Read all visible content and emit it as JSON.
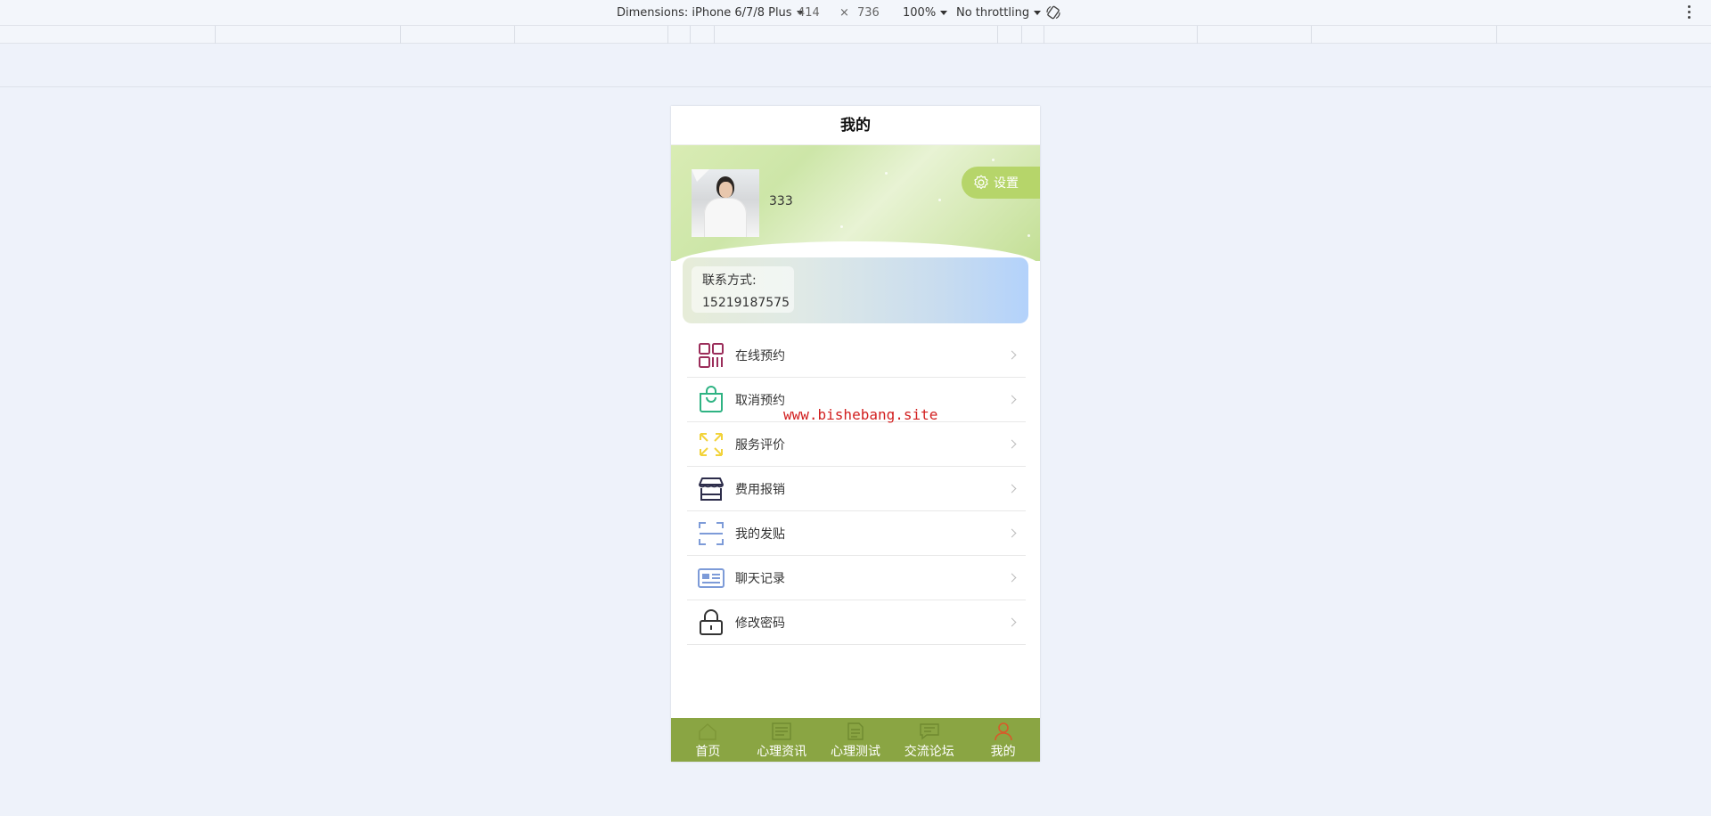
{
  "devtools": {
    "dimensions_label": "Dimensions: iPhone 6/7/8 Plus",
    "width": "414",
    "times": "×",
    "height": "736",
    "zoom": "100%",
    "throttling": "No throttling"
  },
  "page": {
    "title": "我的",
    "username": "333",
    "settings_label": "设置",
    "contact_label": "联系方式:",
    "contact_value": "15219187575"
  },
  "menu": [
    {
      "label": "在线预约",
      "icon": "grid-icon",
      "color": "#9b2d5a"
    },
    {
      "label": "取消预约",
      "icon": "shopping-bag-icon",
      "color": "#2fb383"
    },
    {
      "label": "服务评价",
      "icon": "expand-arrows-icon",
      "color": "#f2d33a"
    },
    {
      "label": "费用报销",
      "icon": "store-icon",
      "color": "#2c2c4a"
    },
    {
      "label": "我的发贴",
      "icon": "scan-frame-icon",
      "color": "#7d9bd8"
    },
    {
      "label": "聊天记录",
      "icon": "id-card-icon",
      "color": "#7d9bd8"
    },
    {
      "label": "修改密码",
      "icon": "lock-icon",
      "color": "#333333"
    }
  ],
  "watermark": "www.bishebang.site",
  "tabbar": [
    {
      "label": "首页",
      "icon": "home-icon",
      "active": false
    },
    {
      "label": "心理资讯",
      "icon": "news-icon",
      "active": false
    },
    {
      "label": "心理测试",
      "icon": "test-icon",
      "active": false
    },
    {
      "label": "交流论坛",
      "icon": "forum-icon",
      "active": false
    },
    {
      "label": "我的",
      "icon": "user-icon",
      "active": true
    }
  ],
  "colors": {
    "tabbar_bg": "#8aa543",
    "settings_bg": "#b6d56a",
    "active_tab_icon": "#d85a2a"
  }
}
